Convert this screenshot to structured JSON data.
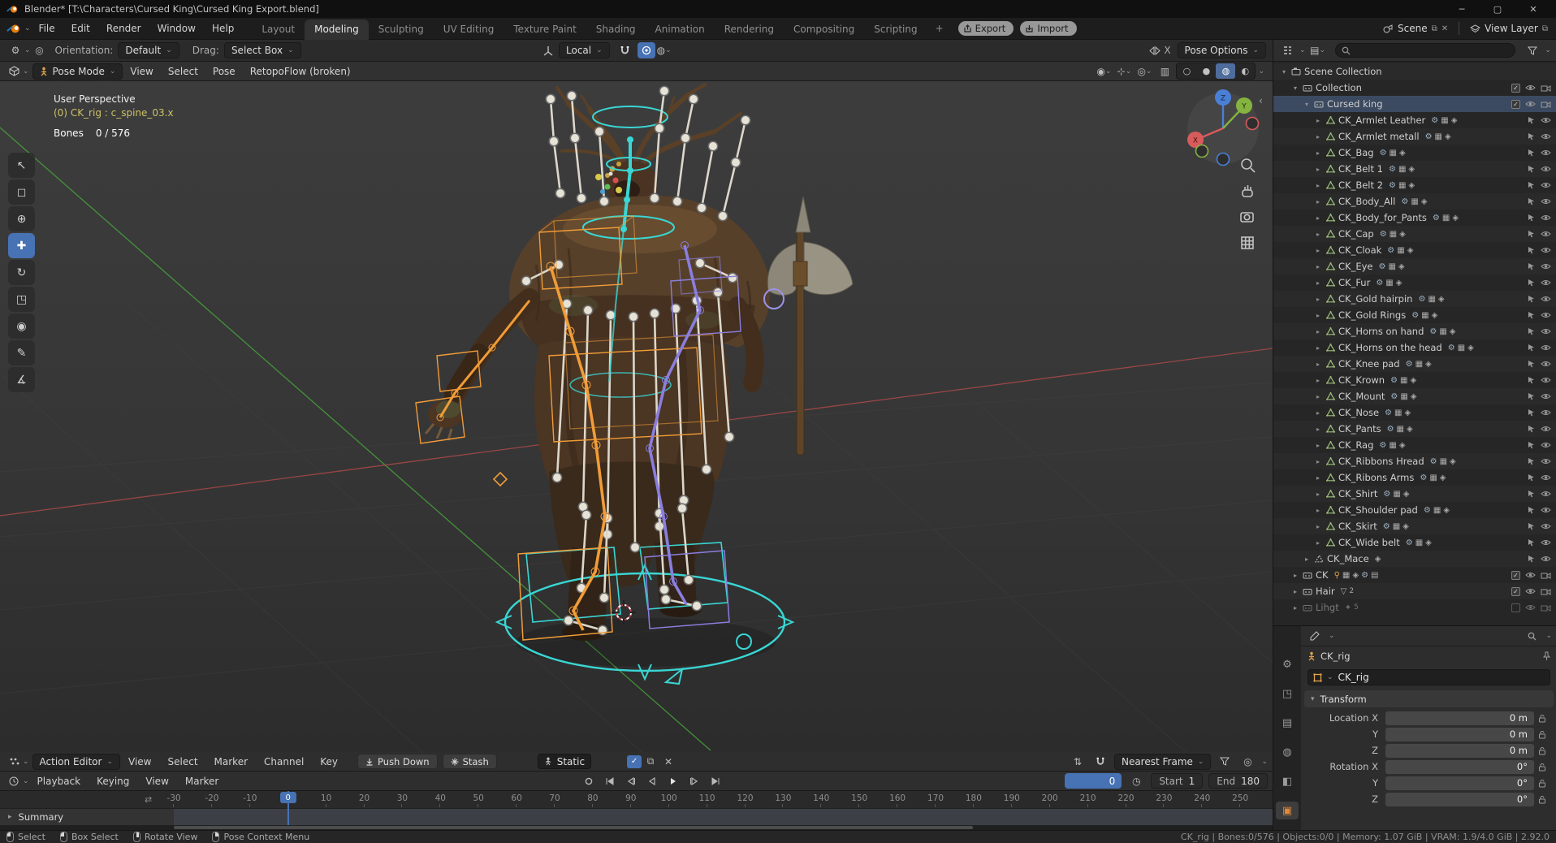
{
  "theme": {
    "accent_blue": "#4772b3",
    "selection_orange": "#f09c38",
    "bone_cyan": "#39d6d4",
    "ik_purple": "#8a7ede"
  },
  "icons": {
    "dropdown": "⌄",
    "expand": "▸",
    "collapse": "▾",
    "minimize": "─",
    "maximize": "▢",
    "close": "✕",
    "plus_tab": "+",
    "panzoom": "⇄"
  },
  "titlebar": {
    "title": "Blender* [T:\\Characters\\Cursed King\\Cursed King Export.blend]"
  },
  "topbar": {
    "menus": [
      "File",
      "Edit",
      "Render",
      "Window",
      "Help"
    ],
    "tabs": [
      {
        "label": "Layout"
      },
      {
        "label": "Modeling",
        "cls": "active"
      },
      {
        "label": "Sculpting"
      },
      {
        "label": "UV Editing"
      },
      {
        "label": "Texture Paint"
      },
      {
        "label": "Shading"
      },
      {
        "label": "Animation"
      },
      {
        "label": "Rendering"
      },
      {
        "label": "Compositing"
      },
      {
        "label": "Scripting"
      }
    ],
    "export_label": "Export",
    "import_label": "Import",
    "scene_label": "Scene",
    "view_layer_label": "View Layer"
  },
  "tool_settings": {
    "orientation_label": "Orientation:",
    "orientation_value": "Default",
    "drag_label": "Drag:",
    "drag_value": "Select Box",
    "transform_orientation": "Local",
    "mirror_label": "X",
    "pose_options_label": "Pose Options"
  },
  "viewport": {
    "mode": "Pose Mode",
    "menus": [
      "View",
      "Select",
      "Pose"
    ],
    "addon_menu": "RetopoFlow (broken)",
    "overlay": {
      "view_label": "User Perspective",
      "active_item": "(0) CK_rig : c_spine_03.x",
      "bones_label": "Bones",
      "bones_value": "0 / 576"
    },
    "gizmo": {
      "x": "X",
      "y": "Y",
      "z": "Z"
    }
  },
  "outliner": {
    "scene_collection": "Scene Collection",
    "collection": "Collection",
    "cursed_king": "Cursed king",
    "objects": [
      "CK_Armlet Leather",
      "CK_Armlet metall",
      "CK_Bag",
      "CK_Belt 1",
      "CK_Belt 2",
      "CK_Body_All",
      "CK_Body_for_Pants",
      "CK_Cap",
      "CK_Cloak",
      "CK_Eye",
      "CK_Fur",
      "CK_Gold hairpin",
      "CK_Gold Rings",
      "CK_Horns on hand",
      "CK_Horns on the head",
      "CK_Knee pad",
      "CK_Krown",
      "CK_Mount",
      "CK_Nose",
      "CK_Pants",
      "CK_Rag",
      "CK_Ribbons Hread",
      "CK_Ribons Arms",
      "CK_Shirt",
      "CK_Shoulder pad",
      "CK_Skirt",
      "CK_Wide belt"
    ],
    "ck_mace": "CK_Mace",
    "ck": "CK",
    "hair": "Hair",
    "hair_badge": "2",
    "light": "Lihgt",
    "light_badge": "5"
  },
  "properties": {
    "breadcrumb": "CK_rig",
    "object_name": "CK_rig",
    "transform_label": "Transform",
    "rows": [
      {
        "label": "Location X",
        "value": "0 m"
      },
      {
        "label": "Y",
        "value": "0 m"
      },
      {
        "label": "Z",
        "value": "0 m"
      },
      {
        "label": "Rotation X",
        "value": "0°"
      },
      {
        "label": "Y",
        "value": "0°"
      },
      {
        "label": "Z",
        "value": "0°"
      }
    ]
  },
  "dopesheet": {
    "editor_mode": "Action Editor",
    "menus": [
      "View",
      "Select",
      "Marker",
      "Channel",
      "Key"
    ],
    "push_down_label": "Push Down",
    "stash_label": "Stash",
    "action_name": "Static",
    "snap_label": "Nearest Frame",
    "summary_label": "Summary"
  },
  "timeline": {
    "menus": [
      "Playback",
      "Keying",
      "View",
      "Marker"
    ],
    "current_frame": "0",
    "start_label": "Start",
    "start_value": "1",
    "end_label": "End",
    "end_value": "180",
    "ticks": [
      -30,
      -20,
      -10,
      0,
      10,
      20,
      30,
      40,
      50,
      60,
      70,
      80,
      90,
      100,
      110,
      120,
      130,
      140,
      150,
      160,
      170,
      180,
      190,
      200,
      210,
      220,
      230,
      240,
      250
    ]
  },
  "statusbar": {
    "hints": [
      {
        "label": "Select",
        "btn": "left"
      },
      {
        "label": "Box Select",
        "btn": "left-drag"
      },
      {
        "label": "Rotate View",
        "btn": "middle"
      },
      {
        "label": "Pose Context Menu",
        "btn": "right"
      }
    ],
    "stats": "CK_rig | Bones:0/576 | Objects:0/0 | Memory: 1.07 GiB | VRAM: 1.9/4.0 GiB | 2.92.0"
  }
}
